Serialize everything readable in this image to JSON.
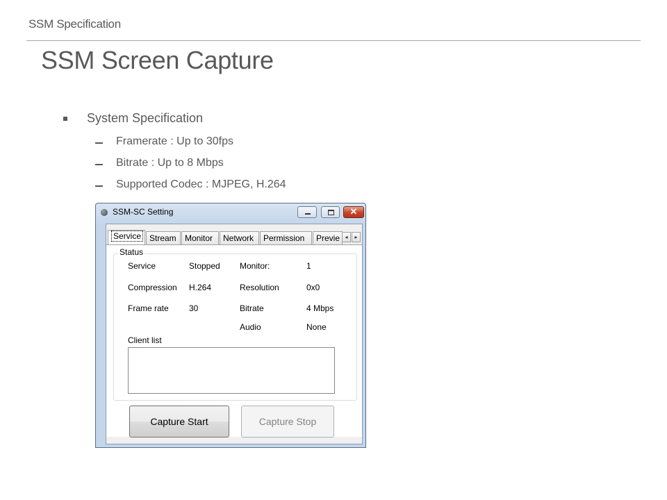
{
  "slide": {
    "header": "SSM Specification",
    "title": "SSM Screen Capture",
    "bullet": "System Specification",
    "sub_bullets": [
      "Framerate : Up to 30fps",
      "Bitrate : Up to 8 Mbps",
      "Supported Codec : MJPEG, H.264"
    ]
  },
  "window": {
    "title": "SSM-SC Setting",
    "close_glyph": "✕",
    "tabs": [
      "Service",
      "Stream",
      "Monitor",
      "Network",
      "Permission",
      "Previe"
    ],
    "active_tab": "Service",
    "scroll_left": "◂",
    "scroll_right": "▸",
    "status_group": "Status",
    "fields": {
      "service_label": "Service",
      "service_value": "Stopped",
      "monitor_label": "Monitor:",
      "monitor_value": "1",
      "compression_label": "Compression",
      "compression_value": "H.264",
      "resolution_label": "Resolution",
      "resolution_value": "0x0",
      "framerate_label": "Frame rate",
      "framerate_value": "30",
      "bitrate_label": "Bitrate",
      "bitrate_value": "4 Mbps",
      "audio_label": "Audio",
      "audio_value": "None"
    },
    "client_list_label": "Client list",
    "capture_start": "Capture Start",
    "capture_stop": "Capture Stop"
  }
}
